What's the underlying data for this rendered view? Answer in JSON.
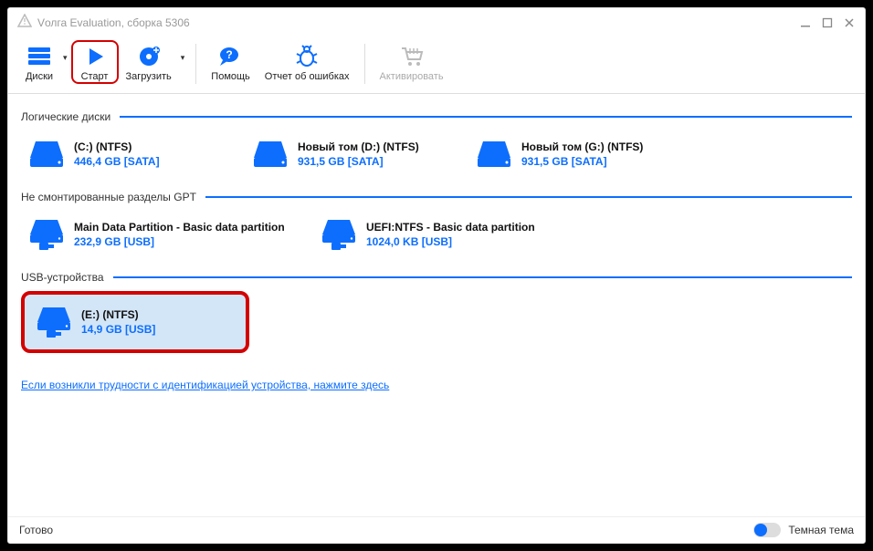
{
  "titlebar": {
    "title": "Vолга Evaluation, сборка 5306"
  },
  "toolbar": {
    "disks": "Диски",
    "start": "Старт",
    "load": "Загрузить",
    "help": "Помощь",
    "bugreport": "Отчет об ошибках",
    "activate": "Активировать"
  },
  "sections": {
    "logical": "Логические диски",
    "gpt": "Не смонтированные разделы GPT",
    "usb": "USB-устройства"
  },
  "drives": {
    "logical": [
      {
        "name": "(C:) (NTFS)",
        "size": "446,4 GB [SATA]"
      },
      {
        "name": "Новый том (D:) (NTFS)",
        "size": "931,5 GB [SATA]"
      },
      {
        "name": "Новый том (G:) (NTFS)",
        "size": "931,5 GB [SATA]"
      }
    ],
    "gpt": [
      {
        "name": "Main Data Partition - Basic data partition",
        "size": "232,9 GB [USB]"
      },
      {
        "name": "UEFI:NTFS - Basic data partition",
        "size": "1024,0 KB [USB]"
      }
    ],
    "usb": [
      {
        "name": "(E:) (NTFS)",
        "size": "14,9 GB [USB]"
      }
    ]
  },
  "helplink": "Если возникли трудности с идентификацией устройства, нажмите здесь",
  "statusbar": {
    "status": "Готово",
    "darktheme": "Темная тема"
  }
}
